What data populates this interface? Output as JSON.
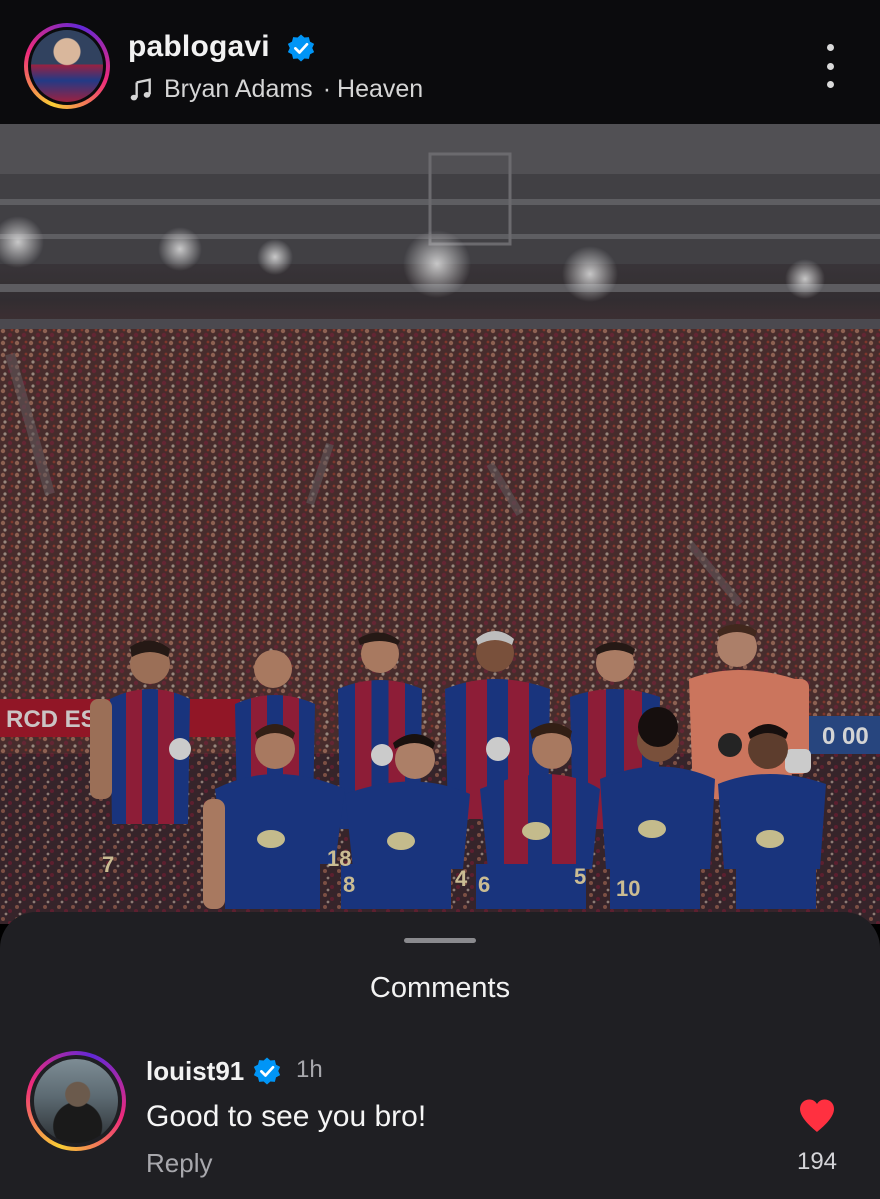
{
  "post": {
    "username": "pablogavi",
    "verified": true,
    "music": {
      "artist": "Bryan Adams",
      "separator": "·",
      "song": "Heaven"
    },
    "menu_icon": "more-vertical-icon"
  },
  "photo": {
    "banner_text": "RCD ESPAN",
    "score_text": "0 00",
    "jersey_numbers": [
      "7",
      "18",
      "8",
      "4",
      "6",
      "5",
      "10"
    ]
  },
  "comments": {
    "title": "Comments",
    "items": [
      {
        "username": "louist91",
        "verified": true,
        "time": "1h",
        "text": "Good to see you bro!",
        "reply_label": "Reply",
        "likes": "194"
      }
    ]
  },
  "colors": {
    "verified_blue": "#0095f6",
    "like_red": "#ff3040",
    "header_bg": "#0b0b0d",
    "sheet_bg": "#1f1f23",
    "barca_blue": "#1d3c8f",
    "barca_red": "#a1213f",
    "keeper_orange": "#e8866a"
  }
}
